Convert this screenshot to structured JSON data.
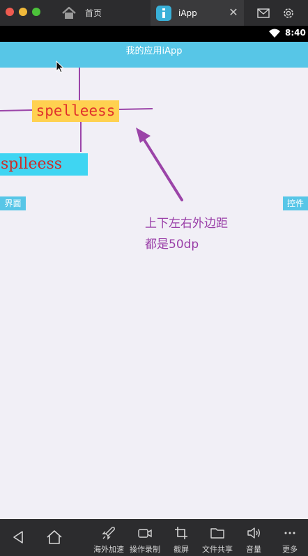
{
  "window": {
    "tabs": [
      {
        "label": "首页",
        "icon": "home-icon"
      },
      {
        "label": "iApp",
        "icon": "iapp-logo-icon",
        "active": true
      }
    ],
    "close_glyph": "✕"
  },
  "status_bar": {
    "time": "8:40",
    "wifi_icon": "wifi-icon"
  },
  "app": {
    "title": "我的应用iApp",
    "accent_color": "#57c6e7"
  },
  "canvas": {
    "label_top": "spelleess",
    "label_bottom": "splleess",
    "annotation_line1": "上下左右外边距",
    "annotation_line2": "都是50dp",
    "tag_left": "界面",
    "tag_right": "控件"
  },
  "bottom_toolbar": {
    "items": [
      {
        "label": "海外加速",
        "icon": "rocket-icon"
      },
      {
        "label": "操作录制",
        "icon": "video-camera-icon"
      },
      {
        "label": "截屏",
        "icon": "crop-icon"
      },
      {
        "label": "文件共享",
        "icon": "folder-icon"
      },
      {
        "label": "音量",
        "icon": "volume-icon"
      },
      {
        "label": "更多",
        "icon": "more-icon"
      }
    ],
    "more_glyph": "···"
  }
}
